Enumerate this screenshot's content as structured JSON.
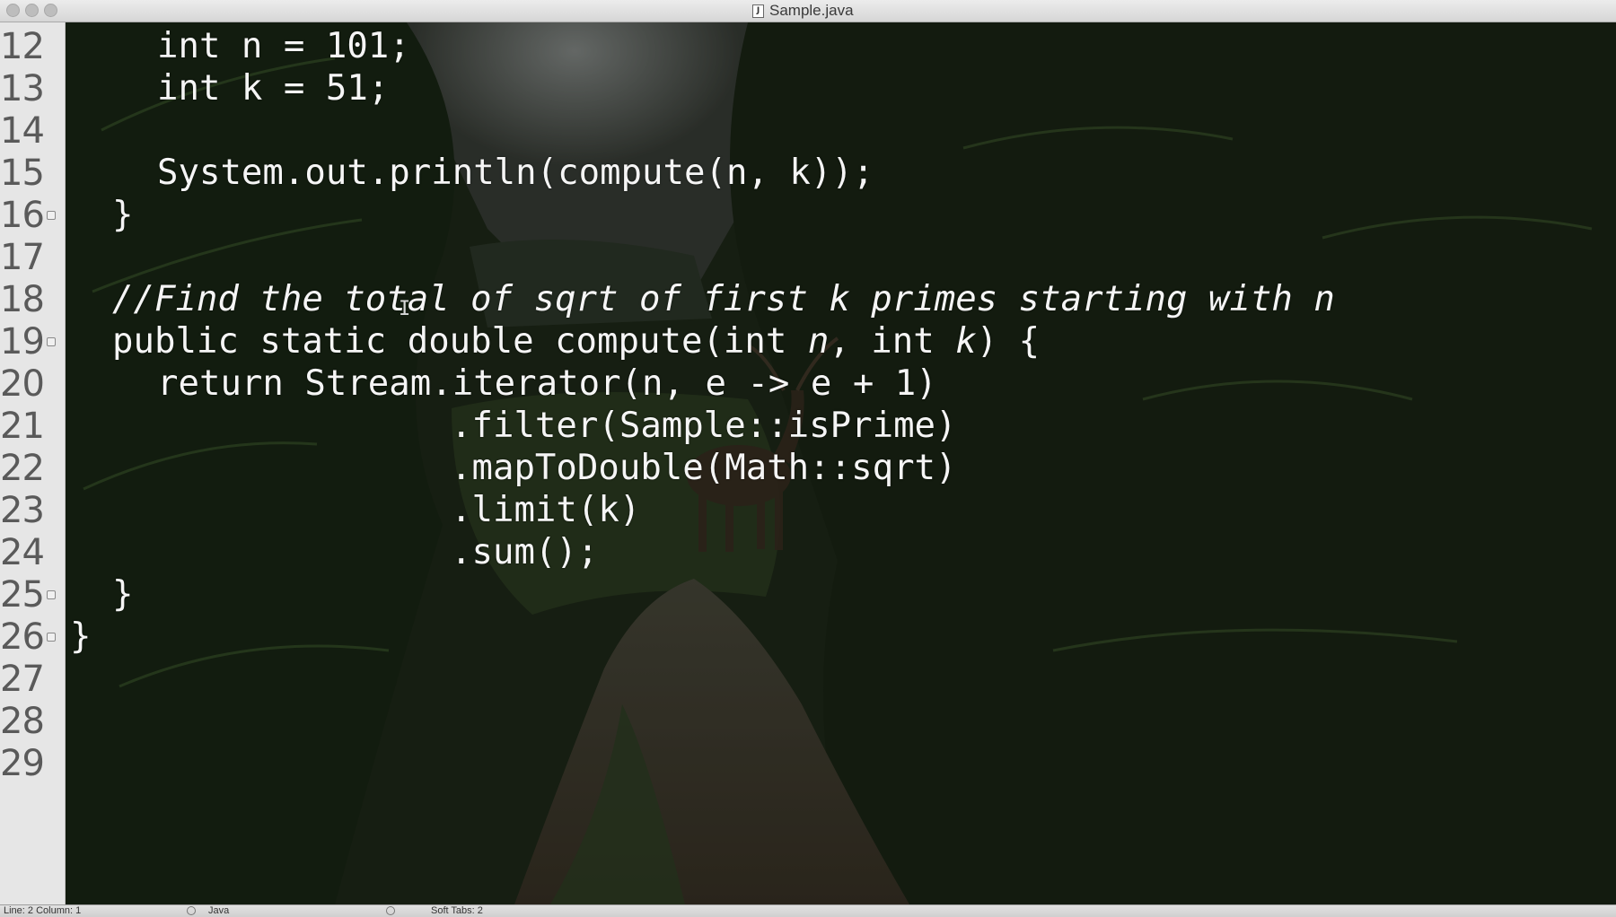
{
  "window": {
    "title": "Sample.java",
    "file_icon": "J"
  },
  "gutter": {
    "line_numbers": [
      "12",
      "13",
      "14",
      "15",
      "16",
      "17",
      "18",
      "19",
      "20",
      "21",
      "22",
      "23",
      "24",
      "25",
      "26",
      "27",
      "28",
      "29"
    ],
    "fold_markers_on": [
      "16",
      "19",
      "25",
      "26"
    ]
  },
  "code": {
    "l12": "int n = 101;",
    "l13": "int k = 51;",
    "l14": "",
    "l15": "System.out.println(compute(n, k));",
    "l16": "}",
    "l17": "",
    "l18": "//Find the total of sqrt of first k primes starting with n",
    "l19_a": "public static double compute(int ",
    "l19_b": "n",
    "l19_c": ", int ",
    "l19_d": "k",
    "l19_e": ") {",
    "l20": "return Stream.iterator(n, e -> e + 1)",
    "l21": ".filter(Sample::isPrime)",
    "l22": ".mapToDouble(Math::sqrt)",
    "l23": ".limit(k)",
    "l24": ".sum();",
    "l25": "}",
    "l26": "}"
  },
  "cursor_glyph": "I",
  "statusbar": {
    "line_col": "Line: 2   Column: 1",
    "language": "Java",
    "tabs": "Soft Tabs:  2"
  },
  "colors": {
    "code_text": "#f5f5f5",
    "gutter_bg": "#e6e6e6",
    "gutter_text": "#5a5a5a"
  }
}
